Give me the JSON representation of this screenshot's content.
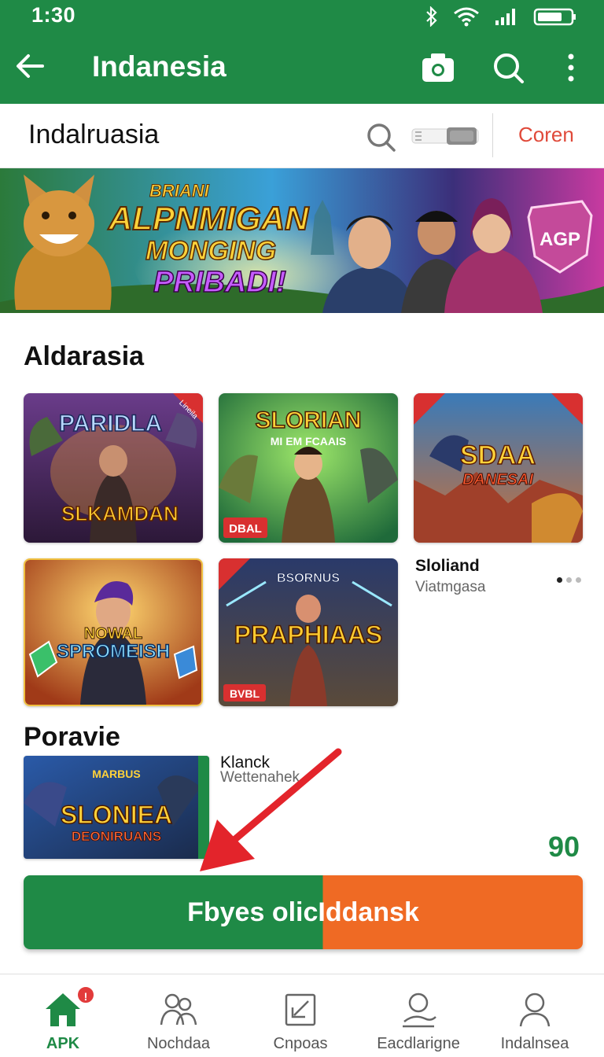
{
  "status_bar": {
    "time": "1:30"
  },
  "app_bar": {
    "title": "Indanesia",
    "icons": [
      "back-arrow-icon",
      "camera-icon",
      "search-icon",
      "more-vertical-icon"
    ]
  },
  "sub_header": {
    "title": "Indalruasia",
    "link": "Coren"
  },
  "banner": {
    "line1": "BRIANI",
    "line2": "ALPNMIGAN",
    "line3": "MONGING",
    "line4": "PRIBADI!",
    "badge": "AGP"
  },
  "section_main": {
    "title": "Aldarasia",
    "cards": [
      {
        "title": "PARIDLA",
        "subtitle": "SLKAMDAN",
        "corner": "Lineila"
      },
      {
        "title": "SLORIAN",
        "subtitle": "MI EM FCAAIS",
        "tag": "DBAL"
      },
      {
        "title": "SDAA",
        "subtitle": "DANESAI"
      },
      {
        "title": "NOWAL",
        "subtitle": "SPROMEISH"
      },
      {
        "title": "PRAPHIAAS",
        "subtitle": "BSORNUS",
        "tag": "BVBL"
      }
    ],
    "side_item": {
      "title": "Sloliand",
      "subtitle": "Viatmgasa"
    }
  },
  "section_secondary": {
    "title": "Poravie",
    "card": {
      "title": "SLONIEA",
      "subtitle": "DEONIRUANS",
      "top": "MARBUS"
    },
    "item": {
      "title": "Klanck",
      "subtitle": "Wettenahek"
    },
    "count": "90"
  },
  "cta": {
    "label": "Fbyes olicIddansk"
  },
  "bottom_nav": [
    {
      "label": "APK",
      "icon": "home-icon",
      "active": true,
      "badge": "!"
    },
    {
      "label": "Nochdaa",
      "icon": "people-icon"
    },
    {
      "label": "Cnpoas",
      "icon": "edit-square-icon"
    },
    {
      "label": "Eacdlarigne",
      "icon": "profile-sign-icon"
    },
    {
      "label": "Indalnsea",
      "icon": "person-icon"
    }
  ],
  "colors": {
    "primary": "#1f8a46",
    "accent": "#ef6a24",
    "link": "#e04a3a",
    "badge": "#e23b3b"
  }
}
